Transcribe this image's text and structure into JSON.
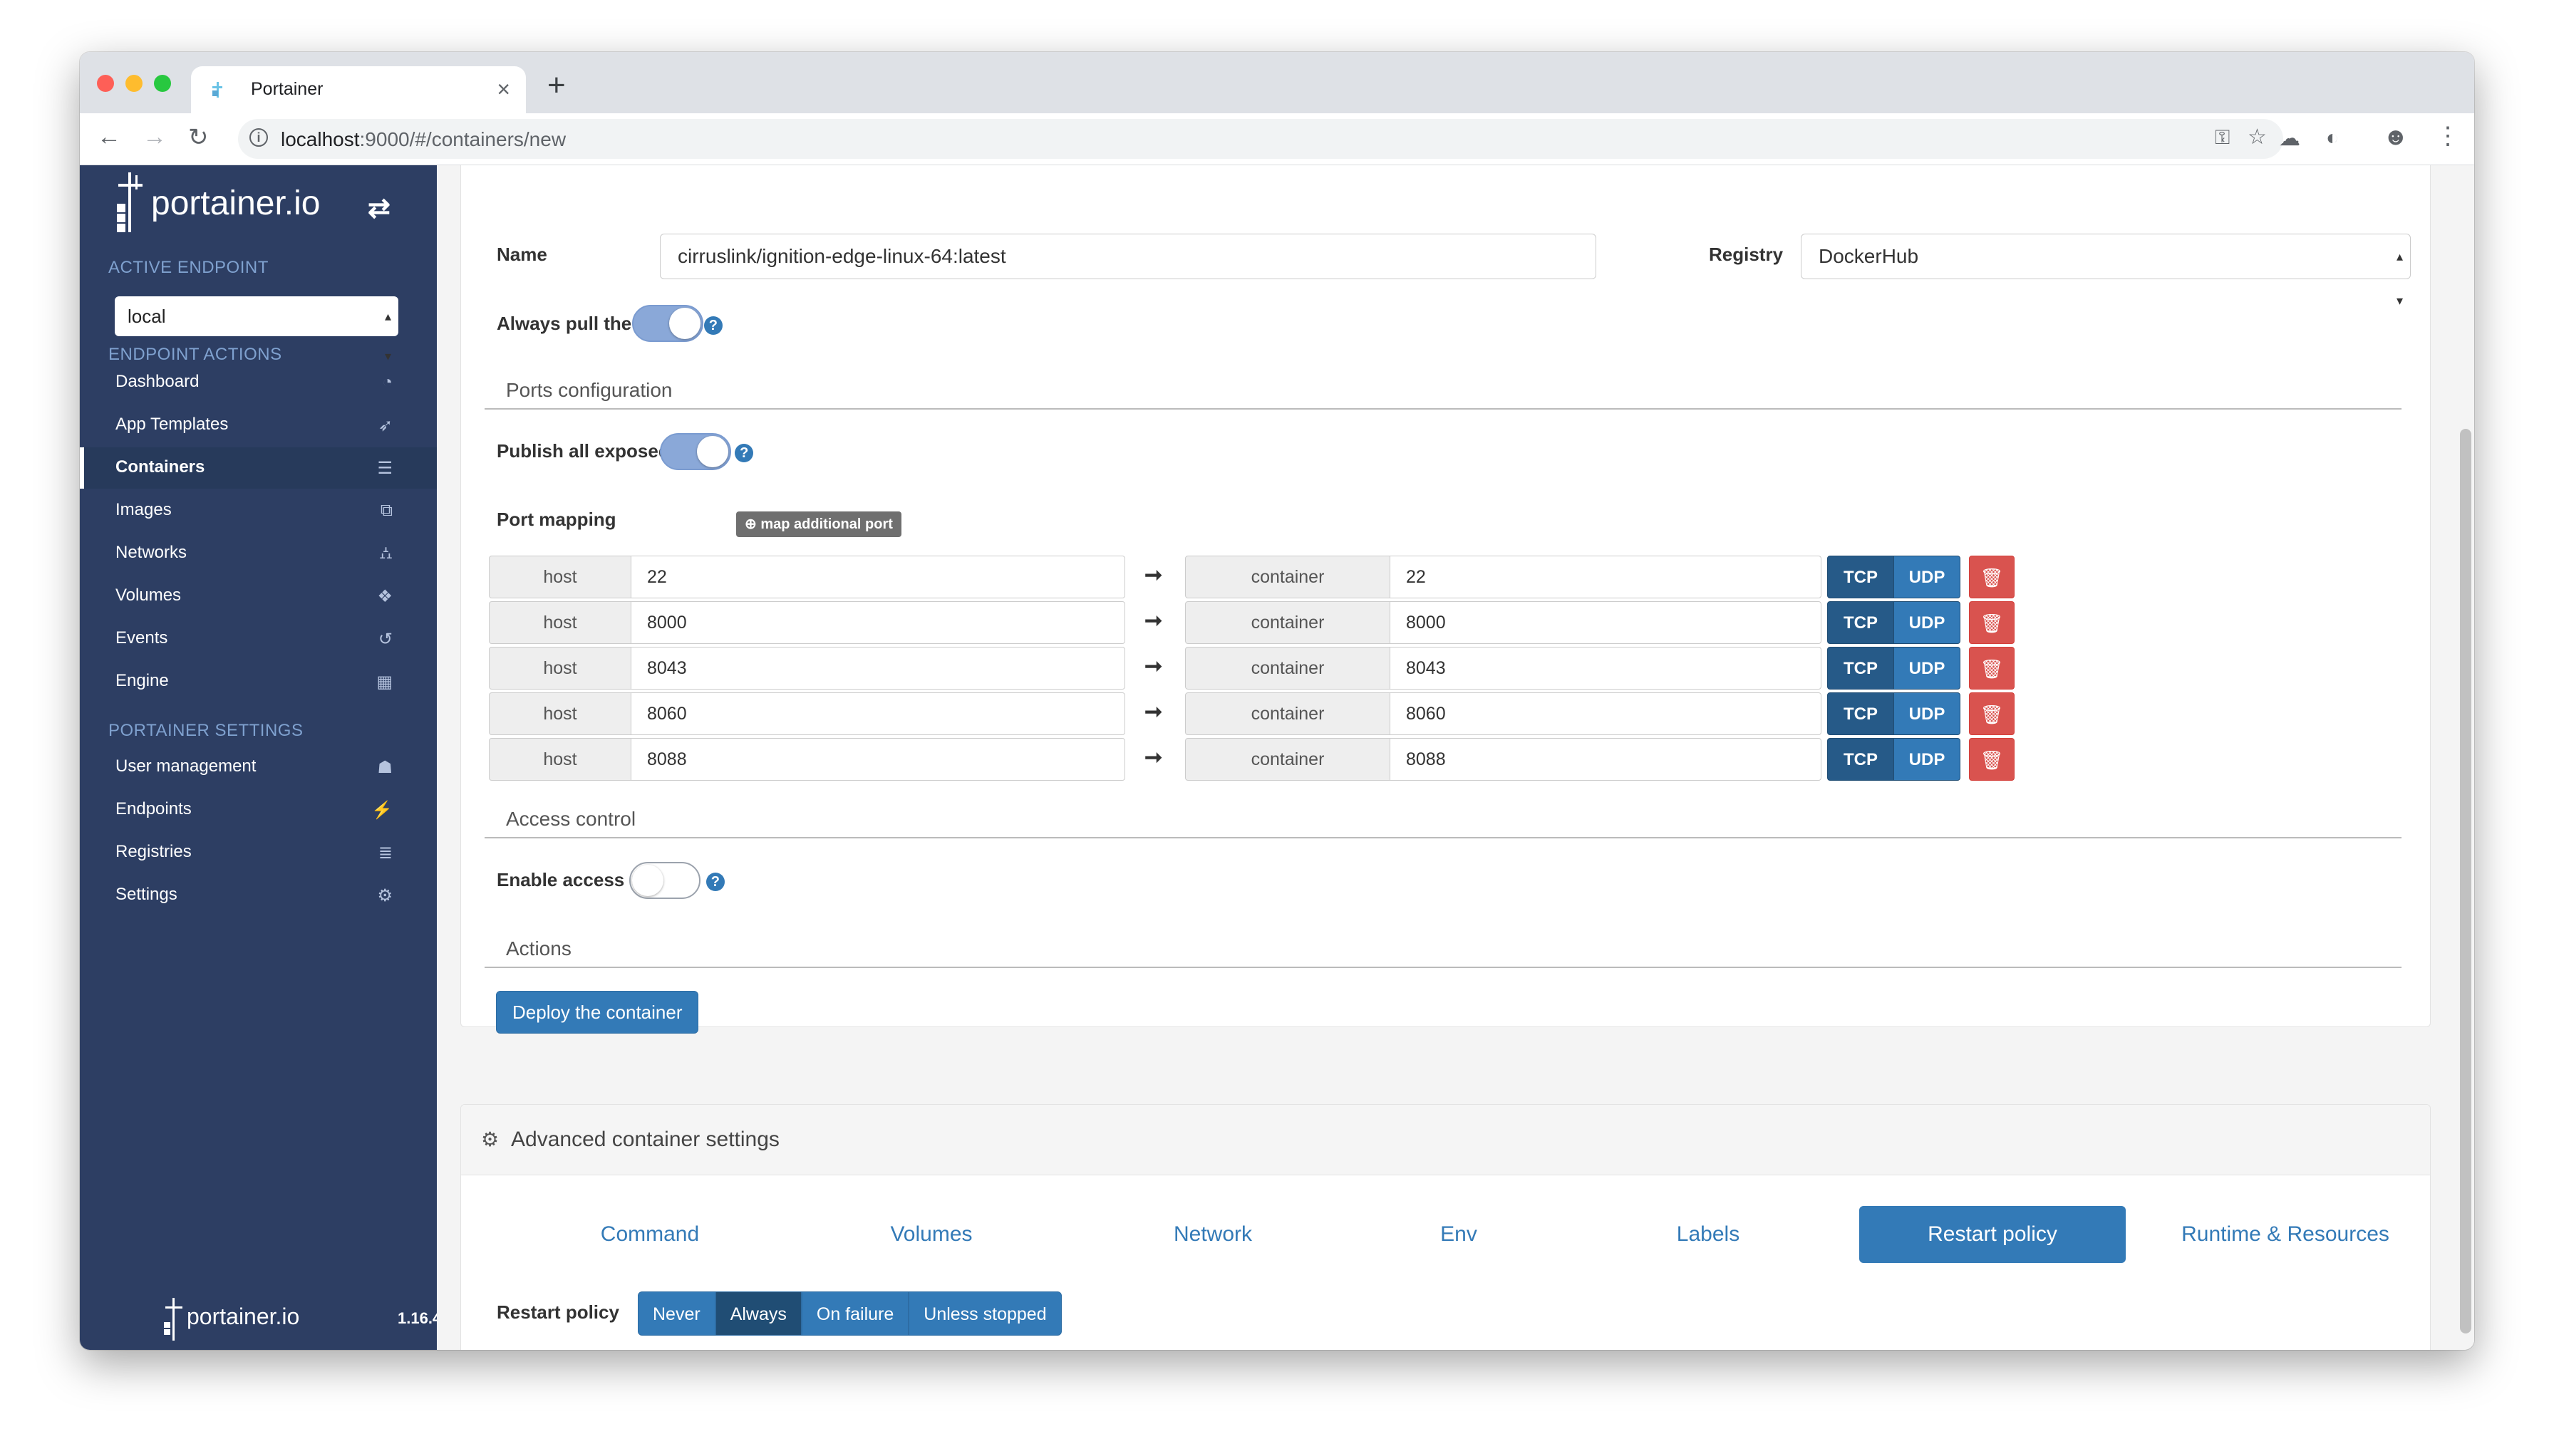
{
  "browser": {
    "tab_title": "Portainer",
    "url_host": "localhost",
    "url_path": ":9000/#/containers/new"
  },
  "sidebar": {
    "logo_text": "portainer.io",
    "active_endpoint_header": "ACTIVE ENDPOINT",
    "endpoint_value": "local",
    "endpoint_actions_header": "ENDPOINT ACTIONS",
    "endpoint_items": [
      {
        "label": "Dashboard",
        "icon": "tachometer-icon"
      },
      {
        "label": "App Templates",
        "icon": "rocket-icon"
      },
      {
        "label": "Containers",
        "icon": "server-icon"
      },
      {
        "label": "Images",
        "icon": "clone-icon"
      },
      {
        "label": "Networks",
        "icon": "sitemap-icon"
      },
      {
        "label": "Volumes",
        "icon": "cubes-icon"
      },
      {
        "label": "Events",
        "icon": "history-icon"
      },
      {
        "label": "Engine",
        "icon": "th-icon"
      }
    ],
    "portainer_settings_header": "PORTAINER SETTINGS",
    "settings_items": [
      {
        "label": "User management",
        "icon": "users-icon"
      },
      {
        "label": "Endpoints",
        "icon": "plug-icon"
      },
      {
        "label": "Registries",
        "icon": "database-icon"
      },
      {
        "label": "Settings",
        "icon": "cogs-icon"
      }
    ],
    "footer_text": "portainer.io",
    "version": "1.16.4"
  },
  "form": {
    "name_label": "Name",
    "name_value": "cirruslink/ignition-edge-linux-64:latest",
    "registry_label": "Registry",
    "registry_value": "DockerHub",
    "always_pull_label": "Always pull the image",
    "always_pull_on": true,
    "ports_section": "Ports configuration",
    "publish_all_label": "Publish all exposed ports",
    "publish_all_on": true,
    "port_mapping_label": "Port mapping",
    "map_port_button": "map additional port",
    "host_addon": "host",
    "container_addon": "container",
    "tcp_label": "TCP",
    "udp_label": "UDP",
    "port_mappings": [
      {
        "host": "22",
        "container": "22"
      },
      {
        "host": "8000",
        "container": "8000"
      },
      {
        "host": "8043",
        "container": "8043"
      },
      {
        "host": "8060",
        "container": "8060"
      },
      {
        "host": "8088",
        "container": "8088"
      }
    ],
    "access_section": "Access control",
    "enable_access_label": "Enable access control",
    "enable_access_on": false,
    "actions_section": "Actions",
    "deploy_button": "Deploy the container"
  },
  "advanced": {
    "title": "Advanced container settings",
    "tabs": [
      "Command",
      "Volumes",
      "Network",
      "Env",
      "Labels",
      "Restart policy",
      "Runtime & Resources"
    ],
    "active_tab": "Restart policy",
    "restart_policy_label": "Restart policy",
    "restart_options": [
      "Never",
      "Always",
      "On failure",
      "Unless stopped"
    ],
    "restart_selected": "Always"
  },
  "colors": {
    "sidebar_bg": "#2d3e63",
    "primary": "#337ab7",
    "danger": "#d9534f"
  }
}
